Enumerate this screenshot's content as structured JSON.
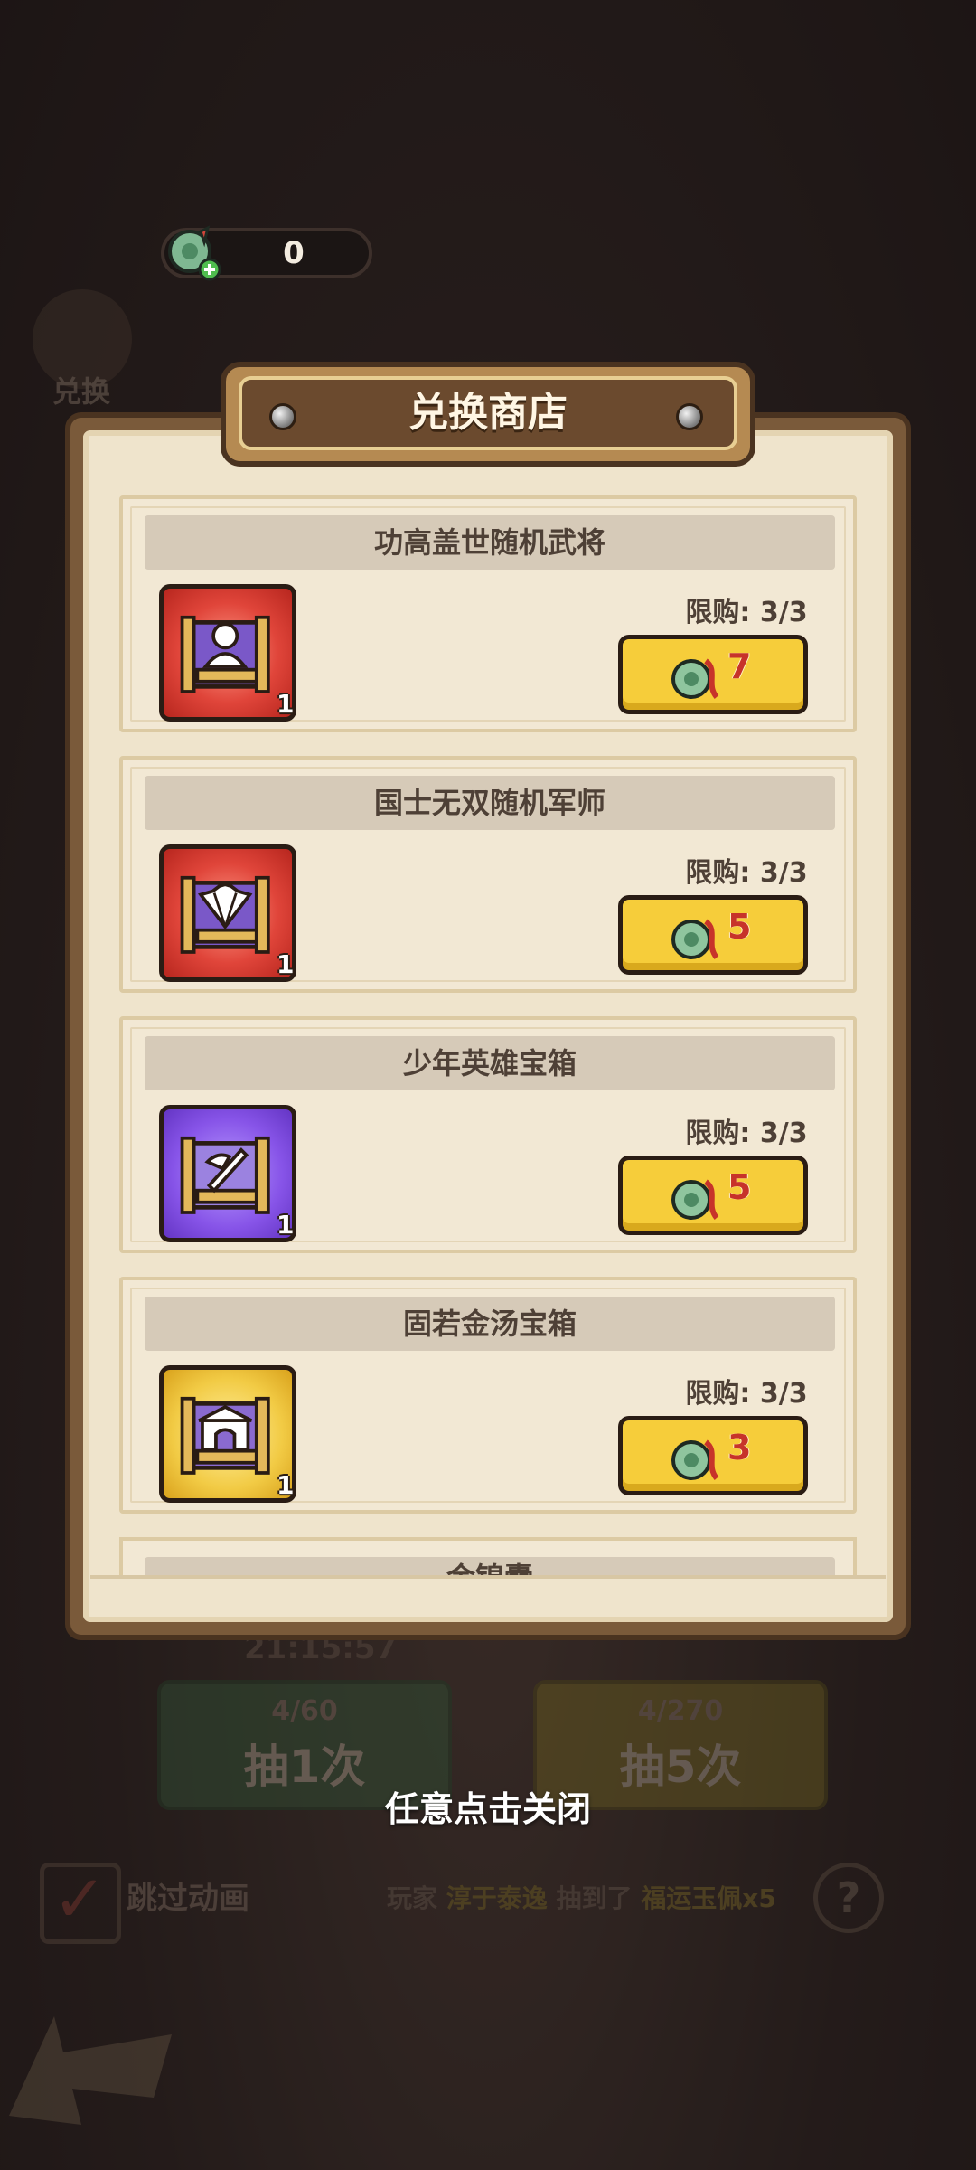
{
  "currency": {
    "value": "0",
    "icon": "jade-coin-icon"
  },
  "background": {
    "exchange_label": "兑换",
    "timer": "21:15:57",
    "draw_once": {
      "count": "4/60",
      "label": "抽1次"
    },
    "draw_five": {
      "count": "4/270",
      "label": "抽5次"
    },
    "skip_animation": "跳过动画",
    "ticker": {
      "prefix": "玩家",
      "player": "淳于泰逸",
      "action": "抽到了",
      "prize": "福运玉佩x5"
    },
    "help": "?"
  },
  "shop": {
    "title": "兑换商店",
    "items": [
      {
        "name": "功高盖世随机武将",
        "limit": "限购: 3/3",
        "price": "7",
        "count": "1",
        "icon": "general-chest-icon",
        "color": "red"
      },
      {
        "name": "国士无双随机军师",
        "limit": "限购: 3/3",
        "price": "5",
        "count": "1",
        "icon": "strategist-chest-icon",
        "color": "red"
      },
      {
        "name": "少年英雄宝箱",
        "limit": "限购: 3/3",
        "price": "5",
        "count": "1",
        "icon": "hero-chest-icon",
        "color": "purple"
      },
      {
        "name": "固若金汤宝箱",
        "limit": "限购: 3/3",
        "price": "3",
        "count": "1",
        "icon": "fortress-chest-icon",
        "color": "gold"
      }
    ],
    "partial_item": "金锦囊"
  },
  "close_hint": "任意点击关闭",
  "colors": {
    "accent_yellow": "#f6cd3a",
    "price_red": "#c7332a",
    "panel_cream": "#efe4cc"
  }
}
